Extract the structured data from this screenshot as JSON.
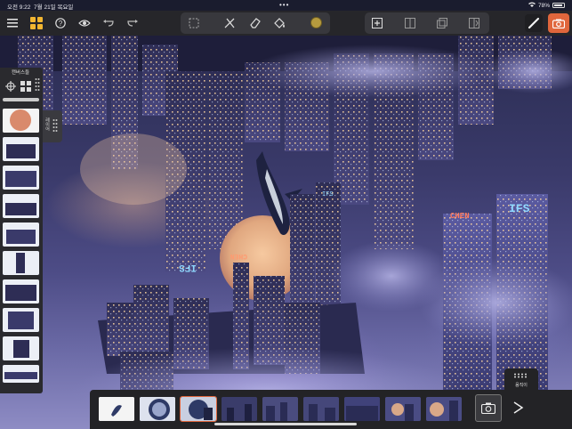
{
  "status": {
    "time": "오전 9:22",
    "date": "7월 21일 목요일",
    "battery": "78%"
  },
  "layer_panel": {
    "title": "캔버스들",
    "tab_label": "레이어",
    "layer_count": 11
  },
  "timeline": {
    "frames": 10,
    "active_frame": 3,
    "settings_label": "움직이",
    "scrubber_progress": 0.18
  },
  "artwork": {
    "signs": [
      "IFS",
      "CHEN",
      "IFS",
      "CHEN"
    ]
  },
  "colors": {
    "accent": "#e0663c",
    "current_color": "#b59a3e",
    "toolbar": "#26262a"
  },
  "icons": [
    "menu-icon",
    "gallery-icon",
    "help-icon",
    "eye-icon",
    "undo-icon",
    "redo-icon",
    "selection-icon",
    "transform-icon",
    "eraser-icon",
    "fill-icon",
    "add-frame-icon",
    "split-icon",
    "clone-icon",
    "flip-icon",
    "brush-icon",
    "camera-icon"
  ]
}
